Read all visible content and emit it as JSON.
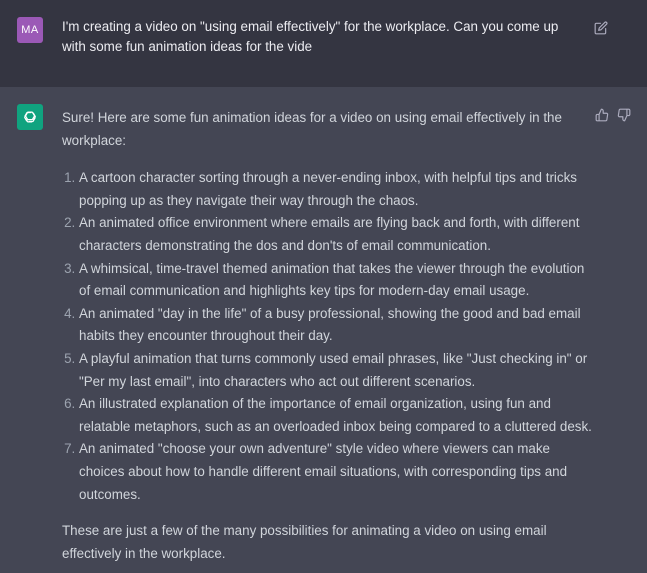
{
  "user": {
    "avatar_initials": "MA",
    "message": "I'm creating a video on \"using email effectively\" for the workplace. Can you come up with some fun animation ideas for the vide"
  },
  "assistant": {
    "intro": "Sure! Here are some fun animation ideas for a video on using email effectively in the workplace:",
    "items": [
      "A cartoon character sorting through a never-ending inbox, with helpful tips and tricks popping up as they navigate their way through the chaos.",
      "An animated office environment where emails are flying back and forth, with different characters demonstrating the dos and don'ts of email communication.",
      "A whimsical, time-travel themed animation that takes the viewer through the evolution of email communication and highlights key tips for modern-day email usage.",
      "An animated \"day in the life\" of a busy professional, showing the good and bad email habits they encounter throughout their day.",
      "A playful animation that turns commonly used email phrases, like \"Just checking in\" or \"Per my last email\", into characters who act out different scenarios.",
      "An illustrated explanation of the importance of email organization, using fun and relatable metaphors, such as an overloaded inbox being compared to a cluttered desk.",
      "An animated \"choose your own adventure\" style video where viewers can make choices about how to handle different email situations, with corresponding tips and outcomes."
    ],
    "outro": "These are just a few of the many possibilities for animating a video on using email effectively in the workplace."
  },
  "icons": {
    "edit": "edit-icon",
    "thumbs_up": "thumbs-up-icon",
    "thumbs_down": "thumbs-down-icon",
    "bot_logo": "openai-logo-icon"
  },
  "colors": {
    "user_bg": "#343541",
    "assistant_bg": "#444654",
    "user_avatar": "#9b59b6",
    "bot_avatar": "#10a37f"
  }
}
